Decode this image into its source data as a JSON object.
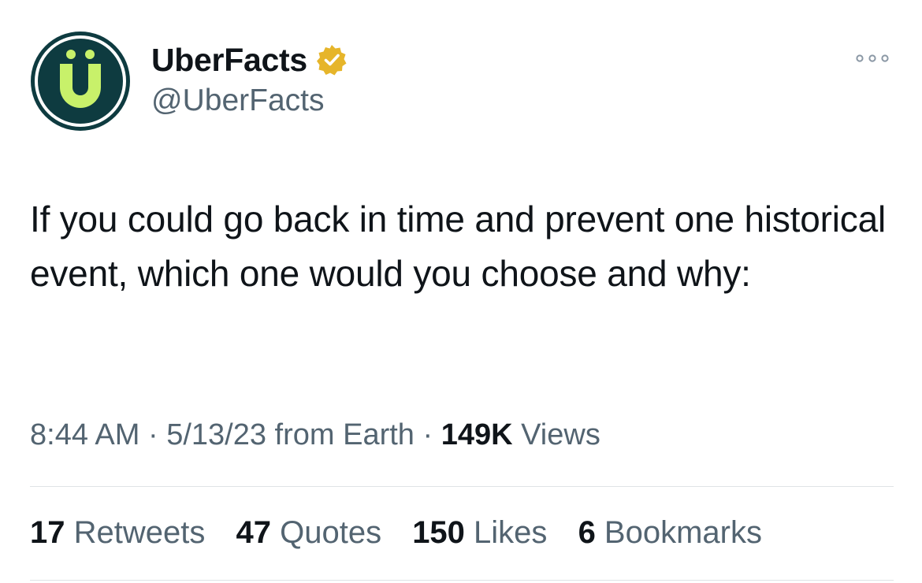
{
  "author": {
    "display_name": "UberFacts",
    "handle": "@UberFacts",
    "avatar_icon": "uberfacts-u-logo",
    "verified_icon": "verified-badge-gold-icon",
    "colors": {
      "avatar_bg": "#0e3b40",
      "avatar_accent": "#c8f16a",
      "badge": "#e6b52a"
    }
  },
  "more_icon": "more-dots-icon",
  "tweet": {
    "text": "If you could go back in time and prevent one historical event, which one would you choose and why:"
  },
  "meta": {
    "time": "8:44 AM",
    "sep1": " · ",
    "date": "5/13/23",
    "source": " from Earth",
    "sep2": " · ",
    "views_count": "149K",
    "views_label": " Views"
  },
  "stats": {
    "retweets_count": "17",
    "retweets_label": " Retweets",
    "quotes_count": "47",
    "quotes_label": " Quotes",
    "likes_count": "150",
    "likes_label": " Likes",
    "bookmarks_count": "6",
    "bookmarks_label": " Bookmarks"
  }
}
